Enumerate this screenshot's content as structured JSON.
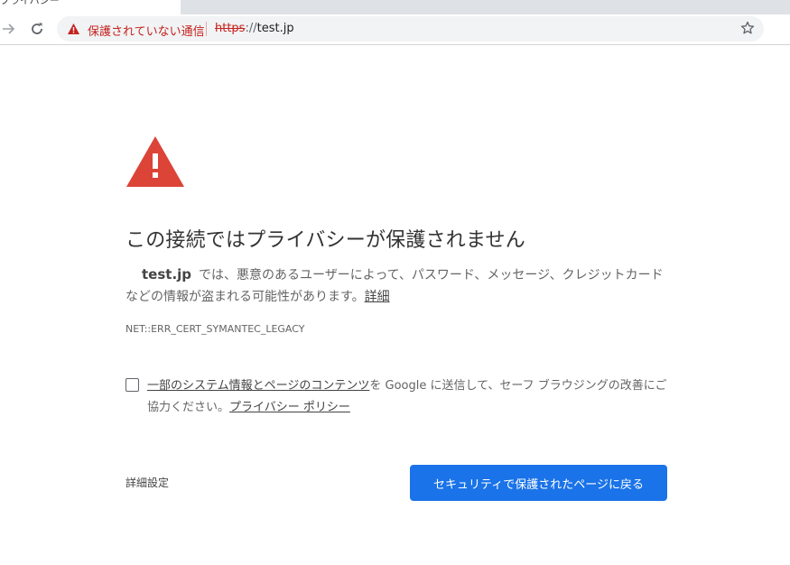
{
  "browser": {
    "tab_title": "プライバシー",
    "security_label": "保護されていない通信",
    "url": {
      "scheme": "https",
      "separator": "://",
      "host": "test.jp"
    }
  },
  "interstitial": {
    "heading": "この接続ではプライバシーが保護されません",
    "host": "test.jp",
    "explanation": "では、悪意のあるユーザーによって、パスワード、メッセージ、クレジットカードなどの情報が盗まれる可能性があります。",
    "learn_more": "詳細",
    "error_code": "NET::ERR_CERT_SYMANTEC_LEGACY",
    "optin_link": "一部のシステム情報とページのコンテンツ",
    "optin_text": "を Google に送信して、セーフ ブラウジングの改善にご協力ください。",
    "privacy_link": "プライバシー ポリシー",
    "details_button": "詳細設定",
    "primary_button": "セキュリティで保護されたページに戻る"
  },
  "colors": {
    "warning_red": "#db4437",
    "primary_blue": "#1a73e8",
    "insecure_text": "#c5221f"
  }
}
